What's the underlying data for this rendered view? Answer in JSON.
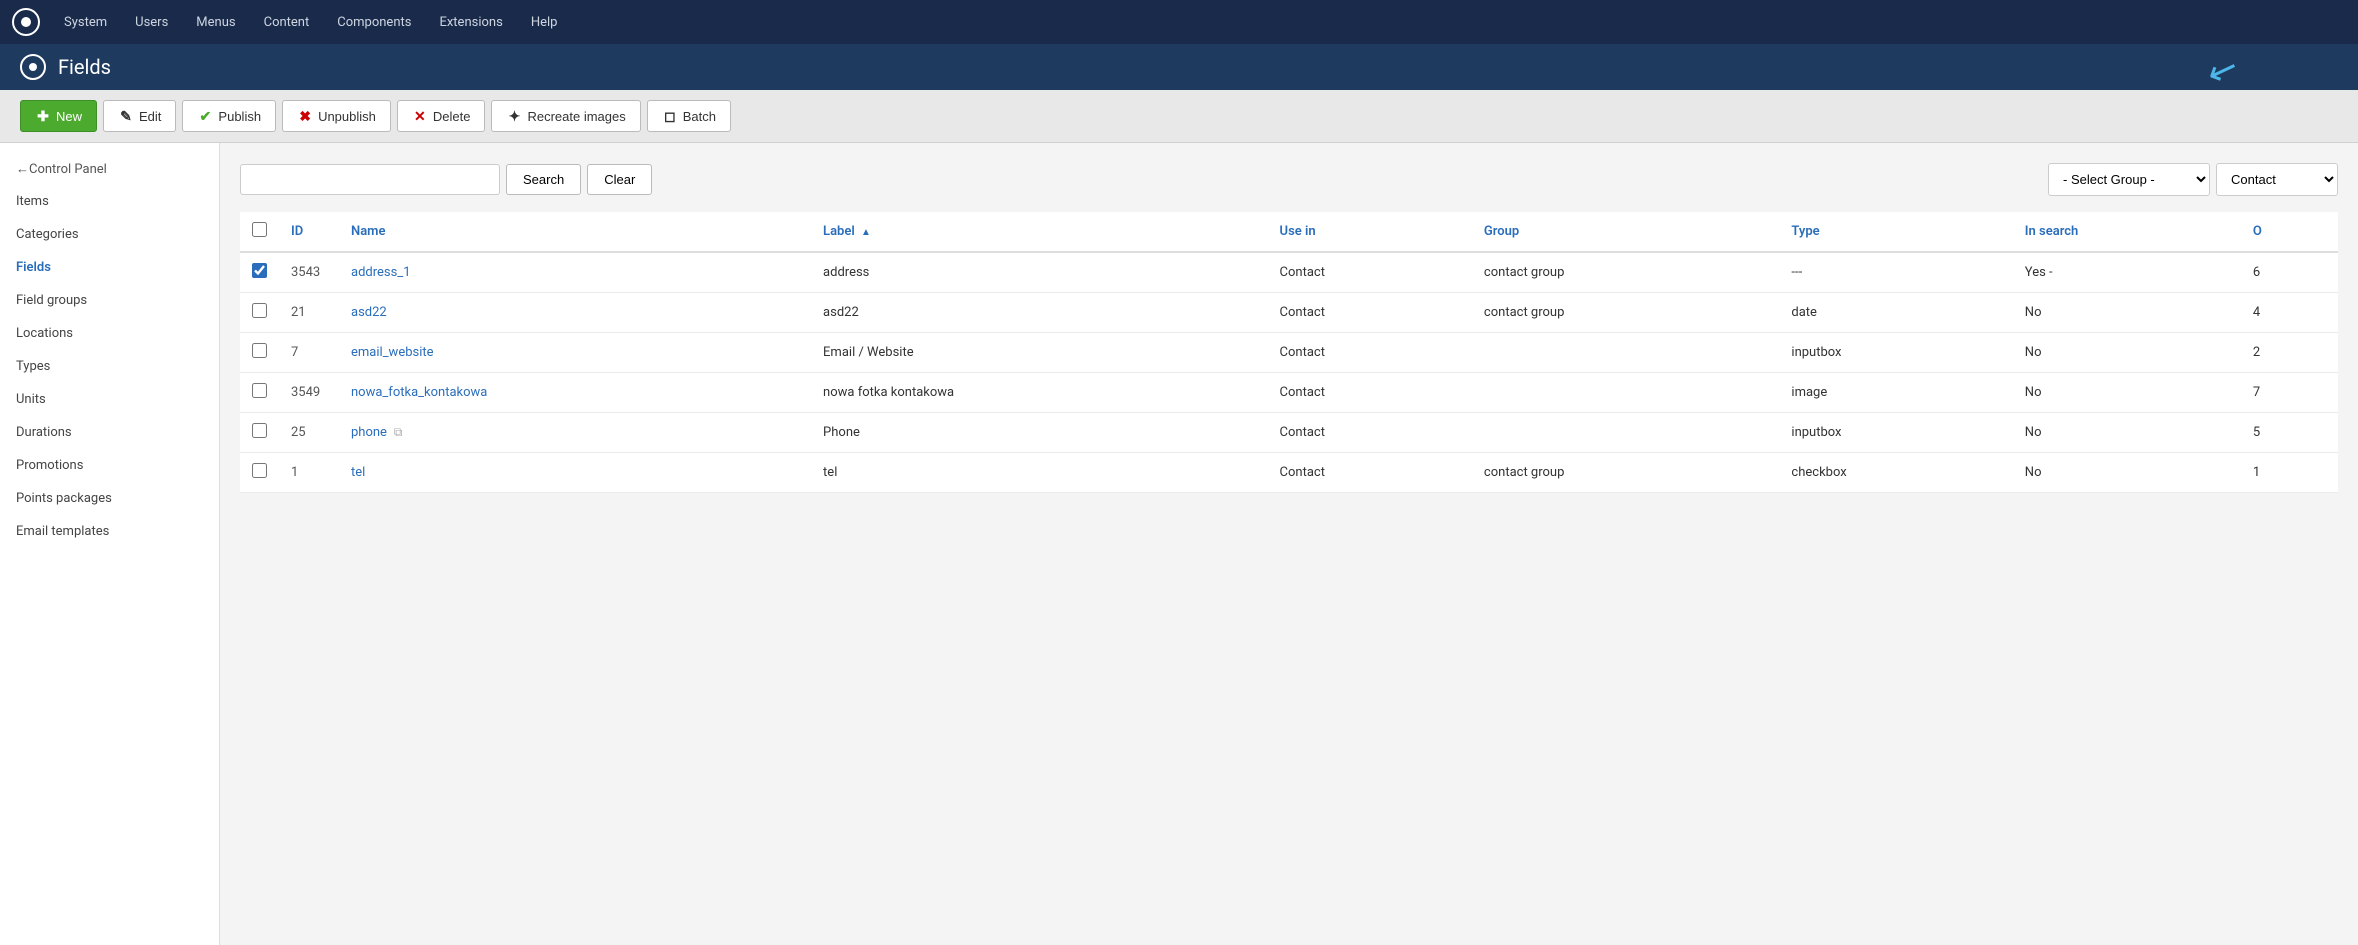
{
  "topnav": {
    "items": [
      "System",
      "Users",
      "Menus",
      "Content",
      "Components",
      "Extensions",
      "Help"
    ]
  },
  "page": {
    "title": "Fields"
  },
  "toolbar": {
    "new_label": "New",
    "edit_label": "Edit",
    "publish_label": "Publish",
    "unpublish_label": "Unpublish",
    "delete_label": "Delete",
    "recreate_label": "Recreate images",
    "batch_label": "Batch"
  },
  "sidebar": {
    "back_label": "←",
    "control_panel": "Control Panel",
    "items": [
      {
        "id": "items",
        "label": "Items"
      },
      {
        "id": "categories",
        "label": "Categories"
      },
      {
        "id": "fields",
        "label": "Fields",
        "active": true
      },
      {
        "id": "field-groups",
        "label": "Field groups"
      },
      {
        "id": "locations",
        "label": "Locations"
      },
      {
        "id": "types",
        "label": "Types"
      },
      {
        "id": "units",
        "label": "Units"
      },
      {
        "id": "durations",
        "label": "Durations"
      },
      {
        "id": "promotions",
        "label": "Promotions"
      },
      {
        "id": "points-packages",
        "label": "Points packages"
      },
      {
        "id": "email-templates",
        "label": "Email templates"
      }
    ]
  },
  "search": {
    "placeholder": "",
    "search_button": "Search",
    "clear_button": "Clear",
    "group_placeholder": "- Select Group -",
    "contact_value": "Contact"
  },
  "table": {
    "columns": [
      {
        "id": "id",
        "label": "ID",
        "sortable": true
      },
      {
        "id": "name",
        "label": "Name",
        "sortable": true
      },
      {
        "id": "label",
        "label": "Label",
        "sortable": true,
        "sorted": true,
        "sort_dir": "asc"
      },
      {
        "id": "use_in",
        "label": "Use in",
        "sortable": true
      },
      {
        "id": "group",
        "label": "Group",
        "sortable": true
      },
      {
        "id": "type",
        "label": "Type",
        "sortable": true
      },
      {
        "id": "in_search",
        "label": "In search",
        "sortable": true
      },
      {
        "id": "ordering",
        "label": "O",
        "sortable": true
      }
    ],
    "rows": [
      {
        "checked": true,
        "id": "3543",
        "name": "address_1",
        "label": "address",
        "use_in": "Contact",
        "group": "contact group",
        "type": "---",
        "in_search": "Yes -",
        "ordering": "6"
      },
      {
        "checked": false,
        "id": "21",
        "name": "asd22",
        "label": "asd22",
        "use_in": "Contact",
        "group": "contact group",
        "type": "date",
        "in_search": "No",
        "ordering": "4"
      },
      {
        "checked": false,
        "id": "7",
        "name": "email_website",
        "label": "Email / Website",
        "use_in": "Contact",
        "group": "",
        "type": "inputbox",
        "in_search": "No",
        "ordering": "2"
      },
      {
        "checked": false,
        "id": "3549",
        "name": "nowa_fotka_kontakowa",
        "label": "nowa fotka kontakowa",
        "use_in": "Contact",
        "group": "",
        "type": "image",
        "in_search": "No",
        "ordering": "7"
      },
      {
        "checked": false,
        "id": "25",
        "name": "phone",
        "has_copy_icon": true,
        "label": "Phone",
        "use_in": "Contact",
        "group": "",
        "type": "inputbox",
        "in_search": "No",
        "ordering": "5"
      },
      {
        "checked": false,
        "id": "1",
        "name": "tel",
        "label": "tel",
        "use_in": "Contact",
        "group": "contact group",
        "type": "checkbox",
        "in_search": "No",
        "ordering": "1"
      }
    ]
  }
}
